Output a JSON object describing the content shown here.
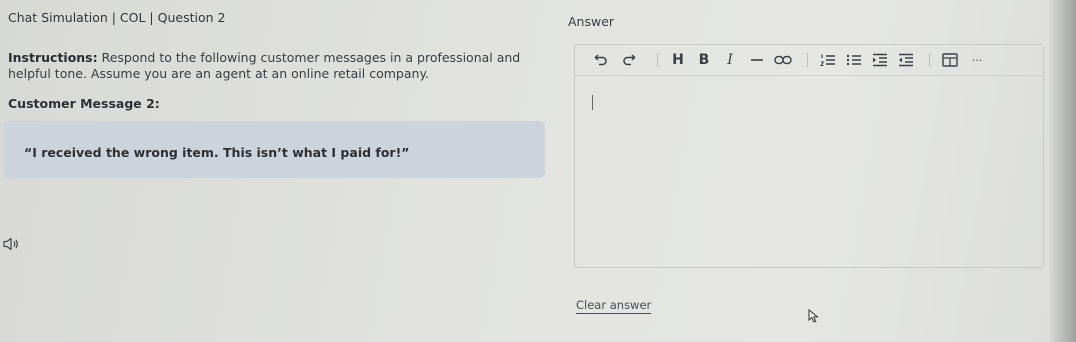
{
  "header": {
    "title": "Chat Simulation | COL | Question 2"
  },
  "instructions": {
    "label": "Instructions:",
    "text": " Respond to the following customer messages in a professional and helpful tone. Assume you are an agent at an online retail company."
  },
  "customer_message": {
    "title": "Customer Message 2:",
    "text": "“I received the wrong item. This isn’t what I paid for!”"
  },
  "answer": {
    "label": "Answer",
    "value": "",
    "toolbar": {
      "heading": "H",
      "bold": "B",
      "italic": "I",
      "more": "···"
    },
    "clear_label": "Clear answer"
  }
}
